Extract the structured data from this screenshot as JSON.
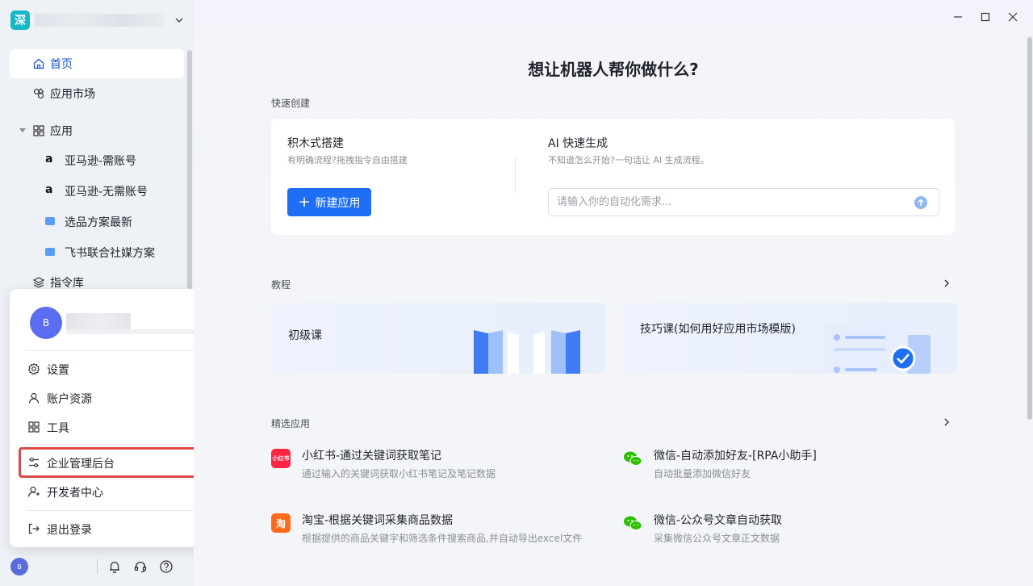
{
  "workspace": {
    "logo_char": "深"
  },
  "nav": {
    "home": "首页",
    "market": "应用市场",
    "apps": "应用",
    "app_items": [
      "亚马逊-需账号",
      "亚马逊-无需账号",
      "选品方案最新",
      "飞书联合社媒方案"
    ],
    "commands": "指令库"
  },
  "user_menu": {
    "avatar_letter": "B",
    "items": {
      "settings": "设置",
      "account": "账户资源",
      "tools": "工具",
      "enterprise": "企业管理后台",
      "developer": "开发者中心",
      "logout": "退出登录"
    }
  },
  "bottom": {
    "avatar_letter": "B"
  },
  "main": {
    "title": "想让机器人帮你做什么?",
    "quick_label": "快速创建",
    "block_title": "积木式搭建",
    "block_desc": "有明确流程?拖拽指令自由搭建",
    "new_app_btn": "新建应用",
    "ai_title": "AI 快速生成",
    "ai_desc": "不知道怎么开始?一句话让 AI 生成流程。",
    "ai_placeholder": "请输入你的自动化需求...",
    "tutorial_label": "教程",
    "tut1": "初级课",
    "tut2": "技巧课(如何用好应用市场模版)",
    "featured_label": "精选应用",
    "apps": [
      {
        "title": "小红书-通过关键词获取笔记",
        "desc": "通过输入的关键词获取小红书笔记及笔记数据",
        "logo": "小红书"
      },
      {
        "title": "微信-自动添加好友-[RPA小助手]",
        "desc": "自动批量添加微信好友",
        "logo": ""
      },
      {
        "title": "淘宝-根据关键词采集商品数据",
        "desc": "根据提供的商品关键字和筛选条件搜索商品,并自动导出excel文件",
        "logo": "淘"
      },
      {
        "title": "微信-公众号文章自动获取",
        "desc": "采集微信公众号文章正文数据",
        "logo": ""
      }
    ]
  },
  "colors": {
    "accent": "#1e6ff5",
    "highlight_border": "#e04848",
    "xhs_red": "#ff2442",
    "taobao_orange": "#ff6a1a",
    "wechat_green": "#2dc100"
  }
}
